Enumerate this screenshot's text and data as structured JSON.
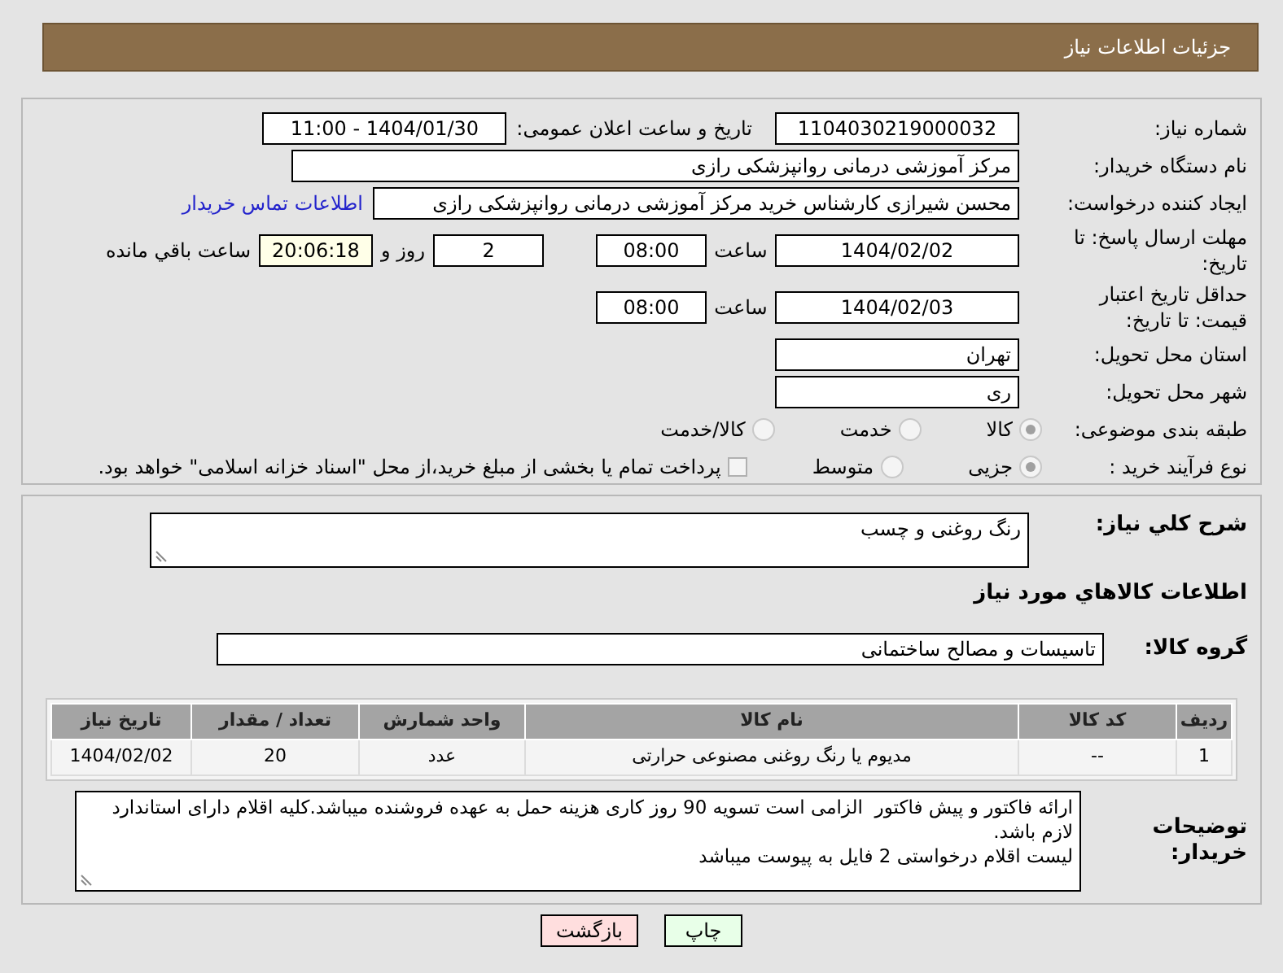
{
  "header": {
    "title": "جزئیات اطلاعات نیاز"
  },
  "need_number": {
    "label": "شماره نیاز:",
    "value": "1104030219000032"
  },
  "announce": {
    "label": "تاریخ و ساعت اعلان عمومی:",
    "value": "1404/01/30 - 11:00"
  },
  "buyer_org": {
    "label": "نام دستگاه خریدار:",
    "value": "مرکز آموزشی درمانی روانپزشکی رازی"
  },
  "requester": {
    "label": "ایجاد کننده درخواست:",
    "value": "محسن شیرازی کارشناس خرید مرکز آموزشی درمانی روانپزشکی رازی",
    "link": "اطلاعات تماس خریدار"
  },
  "reply_deadline": {
    "label": "مهلت ارسال پاسخ: تا تاریخ:",
    "date": "1404/02/02",
    "time_label": "ساعت",
    "time": "08:00",
    "days": "2",
    "days_label": "روز و",
    "remaining": "20:06:18",
    "remaining_label": "ساعت باقي مانده"
  },
  "price_validity": {
    "label": "حداقل تاریخ اعتبار قیمت: تا تاریخ:",
    "date": "1404/02/03",
    "time_label": "ساعت",
    "time": "08:00"
  },
  "province": {
    "label": "استان محل تحویل:",
    "value": "تهران"
  },
  "city": {
    "label": "شهر محل تحویل:",
    "value": "ری"
  },
  "category": {
    "label": "طبقه بندی موضوعی:",
    "options": [
      {
        "label": "کالا",
        "selected": true
      },
      {
        "label": "خدمت",
        "selected": false
      },
      {
        "label": "کالا/خدمت",
        "selected": false
      }
    ]
  },
  "process": {
    "label": "نوع فرآیند خرید :",
    "options": [
      {
        "label": "جزیی",
        "selected": true
      },
      {
        "label": "متوسط",
        "selected": false
      }
    ],
    "checkbox": {
      "label": "پرداخت تمام یا بخشی از مبلغ خرید،از محل \"اسناد خزانه اسلامی\" خواهد بود.",
      "checked": false
    }
  },
  "description": {
    "label": "شرح کلي نیاز:",
    "value": "رنگ روغنی و چسب"
  },
  "items_heading": "اطلاعات کالاهاي مورد نیاز",
  "goods_group": {
    "label": "گروه کالا:",
    "value": "تاسیسات و مصالح ساختمانی"
  },
  "table": {
    "columns": [
      "ردیف",
      "کد کالا",
      "نام کالا",
      "واحد شمارش",
      "تعداد / مقدار",
      "تاریخ نیاز"
    ],
    "rows": [
      [
        "1",
        "--",
        "مدیوم یا رنگ روغنی مصنوعی حرارتی",
        "عدد",
        "20",
        "1404/02/02"
      ]
    ]
  },
  "notes": {
    "label": "توضیحات خریدار:",
    "lines": [
      "ارائه فاکتور و پیش فاکتور  الزامی است تسویه 90 روز کاری هزینه حمل به عهده فروشنده میباشد.کلیه اقلام دارای استاندارد لازم باشد.",
      "لیست اقلام درخواستی 2 فایل به پیوست میباشد"
    ]
  },
  "buttons": [
    {
      "label": "چاپ",
      "kind": "print"
    },
    {
      "label": "بازگشت",
      "kind": "back"
    }
  ]
}
